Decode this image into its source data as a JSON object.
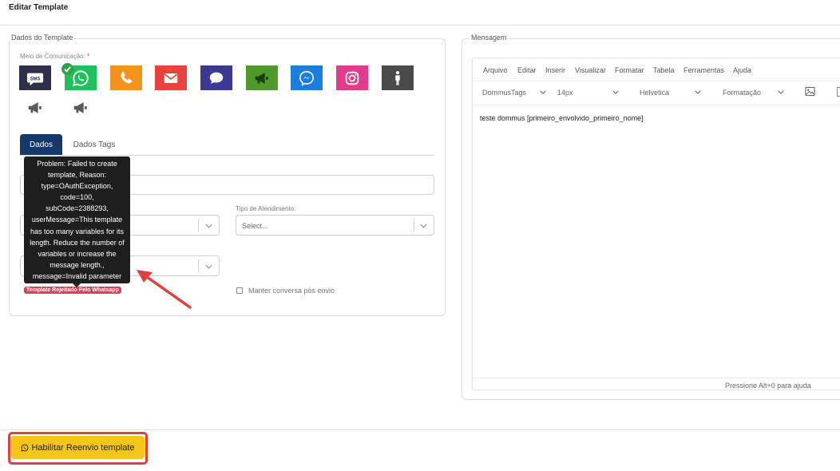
{
  "page_title": "Editar Template",
  "left_panel": {
    "legend": "Dados do Template",
    "channels_label": "Meio de Comunicação:",
    "required_mark": "*",
    "sms_text": "SMS",
    "channels": [
      {
        "name": "sms",
        "color": "#2e3049"
      },
      {
        "name": "whatsapp",
        "color": "#20c05c",
        "selected": true
      },
      {
        "name": "phone",
        "color": "#f5921e"
      },
      {
        "name": "email",
        "color": "#e8423b"
      },
      {
        "name": "chat",
        "color": "#3a3a96"
      },
      {
        "name": "megaphone",
        "color": "#4e9a2a"
      },
      {
        "name": "messenger",
        "color": "#1a7de0"
      },
      {
        "name": "instagram",
        "color": "#e33a8c"
      },
      {
        "name": "person",
        "color": "#4a4a4a"
      },
      {
        "name": "megaphone-gray-1",
        "color": "#ffffff"
      },
      {
        "name": "megaphone-gray-2",
        "color": "#ffffff"
      }
    ],
    "tabs": [
      {
        "label": "Dados",
        "active": true
      },
      {
        "label": "Dados Tags",
        "active": false
      }
    ],
    "tipo_atendimento_label": "Tipo de Atendimento:",
    "select_placeholder": "Select...",
    "manter_conversa_label": "Manter conversa pós envio",
    "manter_conversa_checked": false,
    "rejected_badge": "Template Rejeitado Pelo Whatsapp"
  },
  "tooltip": {
    "lines": [
      "Problem: Failed to create",
      "template, Reason:",
      "type=OAuthException,",
      "code=100,",
      "subCode=2388293,",
      "userMessage=This template",
      "has too many variables for its",
      "length. Reduce the number of",
      "variables or increase the",
      "message length.,",
      "message=Invalid parameter"
    ]
  },
  "right_panel": {
    "legend": "Mensagem",
    "menu": [
      "Arquivo",
      "Editar",
      "Inserir",
      "Visualizar",
      "Formatar",
      "Tabela",
      "Ferramentas",
      "Ajuda"
    ],
    "toolbar": {
      "tags": "DommusTags",
      "font_size": "14px",
      "font_family": "Helvetica",
      "format": "Formatação"
    },
    "content": "teste dommus [primeiro_envolvido_primeiro_nome]",
    "status_help": "Pressione Alt+0 para ajuda"
  },
  "footer": {
    "button_label": "Habilitar Reenvio template"
  },
  "colors": {
    "accent_blue": "#133869",
    "button_yellow": "#f5c518",
    "annotation_red": "#e0413b"
  }
}
